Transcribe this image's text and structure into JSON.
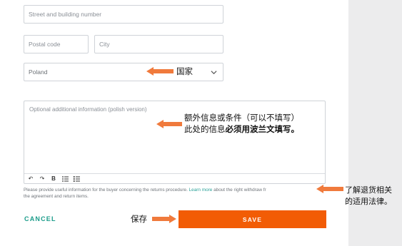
{
  "form": {
    "street_placeholder": "Street and building number",
    "postal_placeholder": "Postal code",
    "city_placeholder": "City",
    "country_value": "Poland",
    "textarea_placeholder": "Optional additional information (polish version)",
    "toolbar": {
      "undo": "↶",
      "redo": "↷",
      "bold": "B",
      "bullet_list": "bullet-list",
      "numbered_list": "numbered-list"
    },
    "help_prefix": "Please provide useful information for the buyer concerning the returns procedure. ",
    "help_link": "Learn more",
    "help_suffix": " about the right withdraw fr",
    "help_line2": "the agreement and return items.",
    "cancel_label": "CANCEL",
    "save_label": "SAVE"
  },
  "annotations": {
    "country": "国家",
    "extra_info_line1": "额外信息或条件（可以不填写）",
    "extra_info_line2_prefix": "此处的信息",
    "extra_info_line2_bold": "必须用波兰文填写。",
    "legal_line1": "了解退货相关",
    "legal_line2": "的适用法律。",
    "save": "保存"
  },
  "colors": {
    "accent": "#f25c05",
    "teal": "#1b9c8a",
    "arrow": "#f07a3c"
  }
}
